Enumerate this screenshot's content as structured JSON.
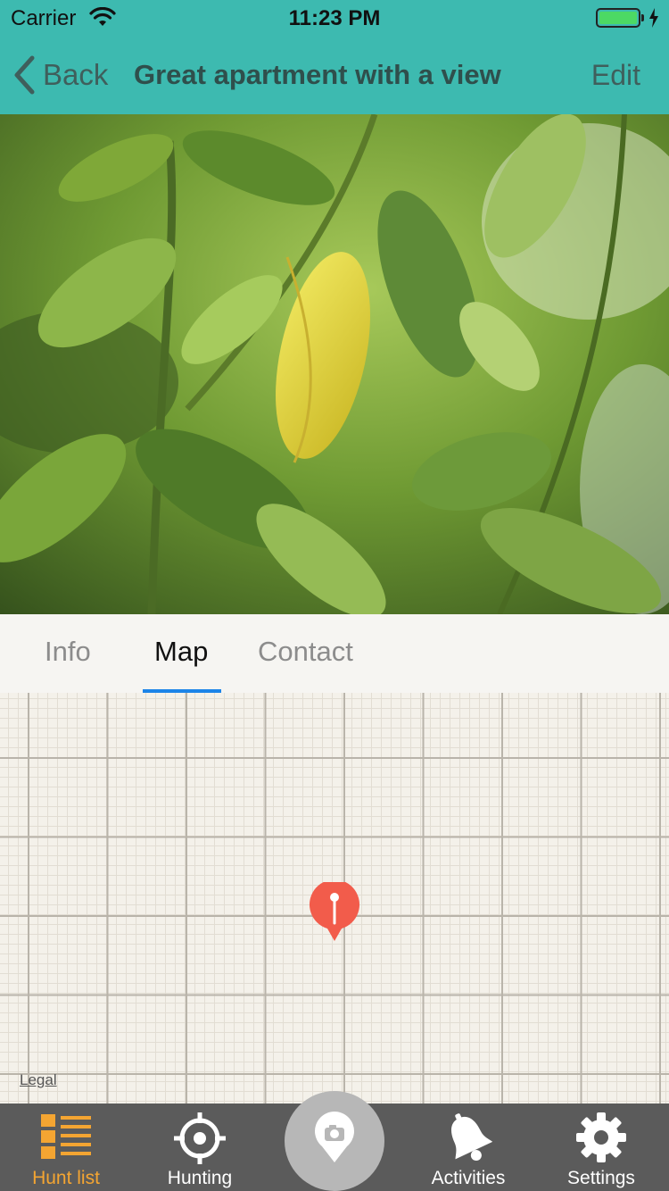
{
  "status_bar": {
    "carrier": "Carrier",
    "time": "11:23 PM",
    "battery_level": 1.0
  },
  "nav": {
    "back_label": "Back",
    "title": "Great apartment with a view",
    "edit_label": "Edit"
  },
  "tabs": [
    {
      "label": "Info",
      "active": false
    },
    {
      "label": "Map",
      "active": true
    },
    {
      "label": "Contact",
      "active": false
    }
  ],
  "map": {
    "legal_label": "Legal",
    "pin_icon": "map-pin-icon"
  },
  "tabbar": {
    "items": [
      {
        "label": "Hunt list",
        "icon": "hunt-list-icon",
        "active": true
      },
      {
        "label": "Hunting",
        "icon": "crosshair-icon",
        "active": false
      },
      {
        "label": "Activities",
        "icon": "bell-icon",
        "active": false
      },
      {
        "label": "Settings",
        "icon": "gear-icon",
        "active": false
      }
    ],
    "center_icon": "camera-location-icon"
  },
  "colors": {
    "nav_bar": "#3dbab0",
    "tab_indicator": "#1c84e8",
    "tabbar_bg": "#5b5b5b",
    "tabbar_active": "#f4a532",
    "pin": "#f25c4b"
  }
}
